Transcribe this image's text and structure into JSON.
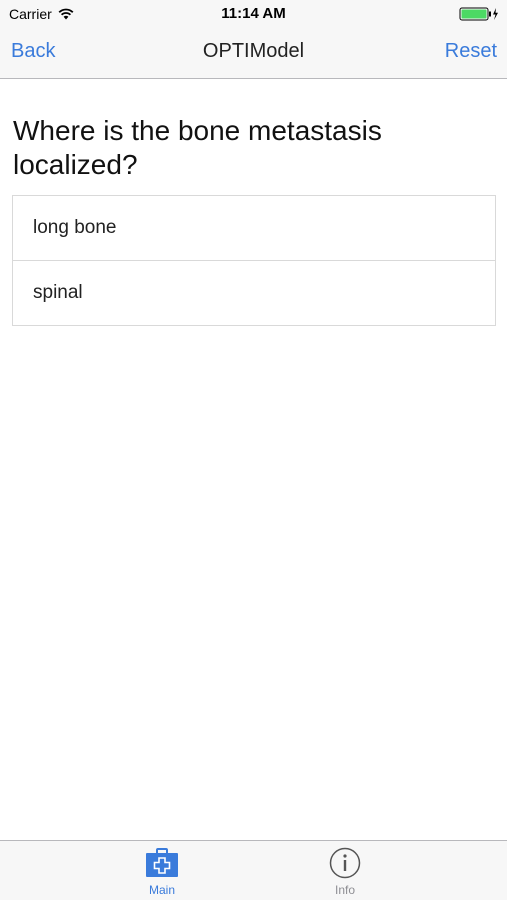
{
  "status_bar": {
    "carrier": "Carrier",
    "time": "11:14 AM",
    "wifi_icon": "wifi-icon",
    "battery_icon": "battery-charging-icon",
    "battery_color": "#4cd964"
  },
  "nav_bar": {
    "back_label": "Back",
    "title": "OPTIModel",
    "reset_label": "Reset",
    "accent_color": "#3a7bdb"
  },
  "question": {
    "text": "Where is the bone metastasis localized?"
  },
  "options": [
    {
      "label": "long bone"
    },
    {
      "label": "spinal"
    }
  ],
  "tab_bar": {
    "tabs": [
      {
        "label": "Main",
        "icon": "medical-kit-icon",
        "selected": true
      },
      {
        "label": "Info",
        "icon": "info-icon",
        "selected": false
      }
    ]
  }
}
